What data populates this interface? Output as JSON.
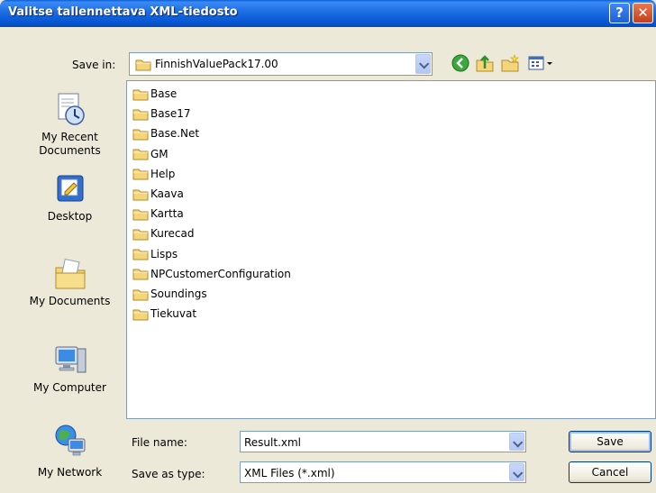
{
  "window": {
    "title": "Valitse tallennettava XML-tiedosto",
    "help_glyph": "?",
    "close_glyph": "✕"
  },
  "toolbar": {
    "save_in_label": "Save in:",
    "save_in_value": "FinnishValuePack17.00",
    "icons": [
      "back-icon",
      "up-folder-icon",
      "new-folder-icon",
      "view-menu-icon"
    ]
  },
  "places": [
    {
      "label": "My Recent Documents",
      "icon": "recent-documents-icon"
    },
    {
      "label": "Desktop",
      "icon": "desktop-icon"
    },
    {
      "label": "My Documents",
      "icon": "my-documents-icon"
    },
    {
      "label": "My Computer",
      "icon": "my-computer-icon"
    },
    {
      "label": "My Network",
      "icon": "my-network-icon"
    }
  ],
  "files": [
    "Base",
    "Base17",
    "Base.Net",
    "GM",
    "Help",
    "Kaava",
    "Kartta",
    "Kurecad",
    "Lisps",
    "NPCustomerConfiguration",
    "Soundings",
    "Tiekuvat"
  ],
  "footer": {
    "file_name_label": "File name:",
    "file_name_value": "Result.xml",
    "save_as_type_label": "Save as type:",
    "save_as_type_value": "XML Files (*.xml)",
    "save_button": "Save",
    "cancel_button": "Cancel"
  },
  "colors": {
    "titlebar": "#0857d4",
    "folder": "#f5d57a",
    "window_bg": "#ece9d8"
  }
}
